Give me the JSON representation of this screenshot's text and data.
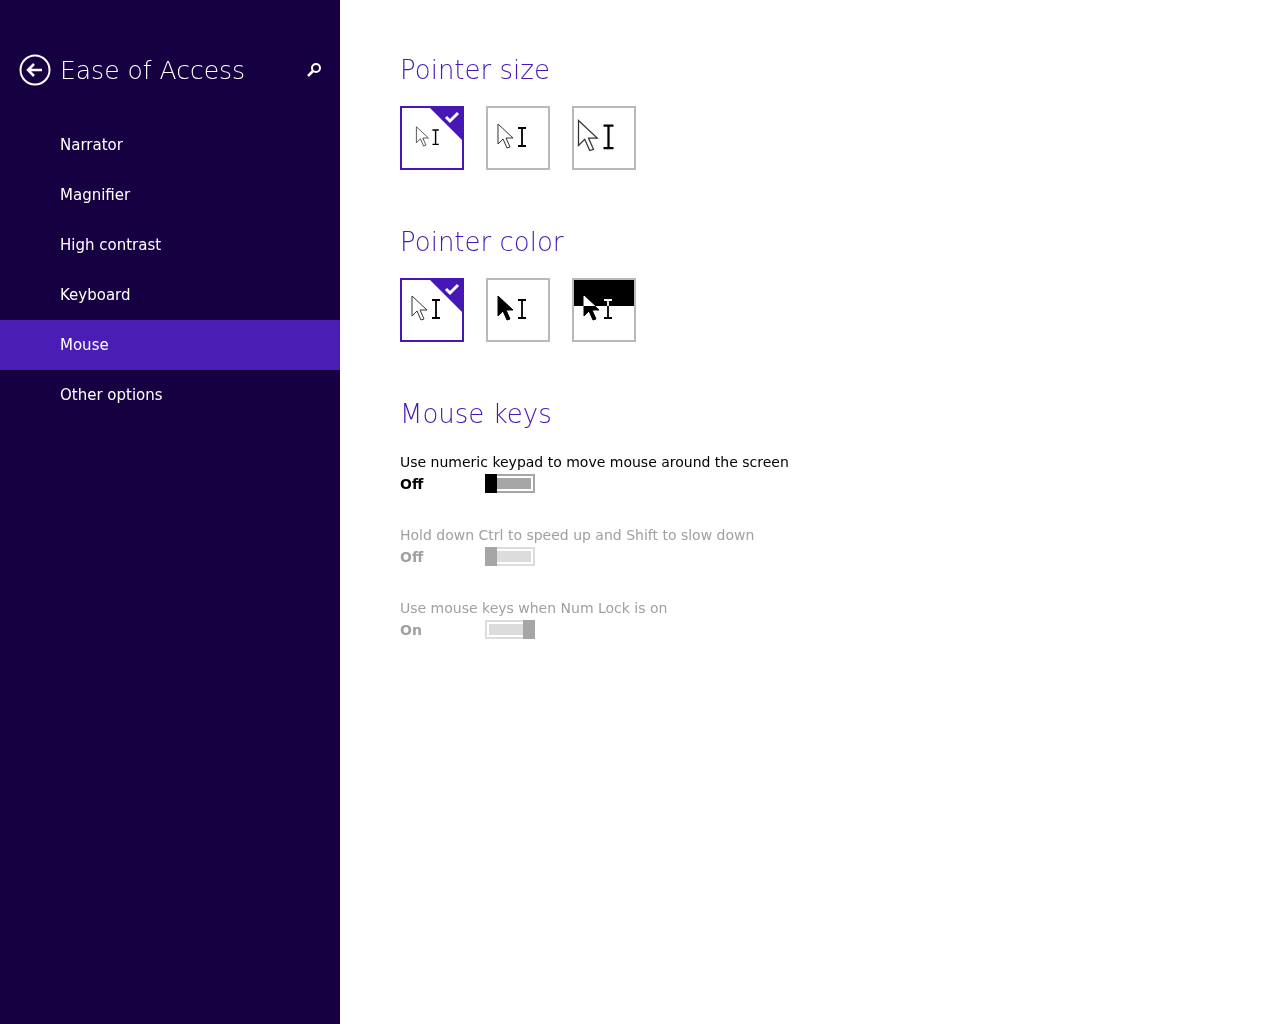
{
  "sidebar": {
    "title": "Ease of Access",
    "items": [
      {
        "label": "Narrator",
        "selected": false
      },
      {
        "label": "Magnifier",
        "selected": false
      },
      {
        "label": "High contrast",
        "selected": false
      },
      {
        "label": "Keyboard",
        "selected": false
      },
      {
        "label": "Mouse",
        "selected": true
      },
      {
        "label": "Other options",
        "selected": false
      }
    ]
  },
  "pointer_size": {
    "heading": "Pointer size",
    "options": [
      {
        "kind": "small",
        "selected": true
      },
      {
        "kind": "medium",
        "selected": false
      },
      {
        "kind": "large",
        "selected": false
      }
    ]
  },
  "pointer_color": {
    "heading": "Pointer color",
    "options": [
      {
        "kind": "white",
        "selected": true
      },
      {
        "kind": "black",
        "selected": false
      },
      {
        "kind": "inverted",
        "selected": false
      }
    ]
  },
  "mouse_keys": {
    "heading": "Mouse keys",
    "settings": [
      {
        "label": "Use numeric keypad to move mouse around the screen",
        "state": "Off",
        "on": false,
        "disabled": false
      },
      {
        "label": "Hold down Ctrl to speed up and Shift to slow down",
        "state": "Off",
        "on": false,
        "disabled": true
      },
      {
        "label": "Use mouse keys when Num Lock is on",
        "state": "On",
        "on": true,
        "disabled": true
      }
    ]
  }
}
